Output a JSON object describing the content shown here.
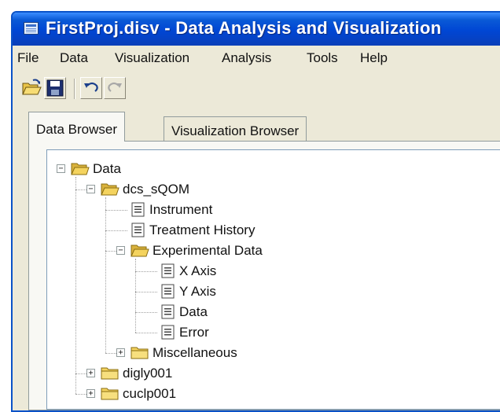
{
  "window": {
    "title": "FirstProj.disv - Data Analysis and Visualization"
  },
  "menu": {
    "items": [
      "File",
      "Data",
      "Visualization",
      "Analysis",
      "Tools",
      "Help"
    ]
  },
  "toolbar": {
    "buttons": [
      "open-folder-icon",
      "save-icon",
      "undo-icon",
      "redo-icon"
    ]
  },
  "tabs": [
    {
      "label": "Data Browser",
      "active": true
    },
    {
      "label": "Visualization Browser",
      "active": false
    }
  ],
  "tree": {
    "nodes": [
      {
        "label": "Data",
        "type": "folder",
        "state": "expanded",
        "depth": 0
      },
      {
        "label": "dcs_sQOM",
        "type": "folder",
        "state": "expanded",
        "depth": 1
      },
      {
        "label": "Instrument",
        "type": "document",
        "depth": 2
      },
      {
        "label": "Treatment History",
        "type": "document",
        "depth": 2
      },
      {
        "label": "Experimental Data",
        "type": "folder",
        "state": "expanded",
        "depth": 2
      },
      {
        "label": "X Axis",
        "type": "document",
        "depth": 3
      },
      {
        "label": "Y Axis",
        "type": "document",
        "depth": 3
      },
      {
        "label": "Data",
        "type": "document",
        "depth": 3
      },
      {
        "label": "Error",
        "type": "document",
        "depth": 3
      },
      {
        "label": "Miscellaneous",
        "type": "folder",
        "state": "collapsed",
        "depth": 2
      },
      {
        "label": "digly001",
        "type": "folder",
        "state": "collapsed",
        "depth": 1
      },
      {
        "label": "cuclp001",
        "type": "folder",
        "state": "collapsed",
        "depth": 1
      }
    ]
  },
  "colors": {
    "titlebar": "#0046d4",
    "chrome": "#ece9d8",
    "folder": "#f4d35e",
    "tree_background": "#ffffff"
  }
}
